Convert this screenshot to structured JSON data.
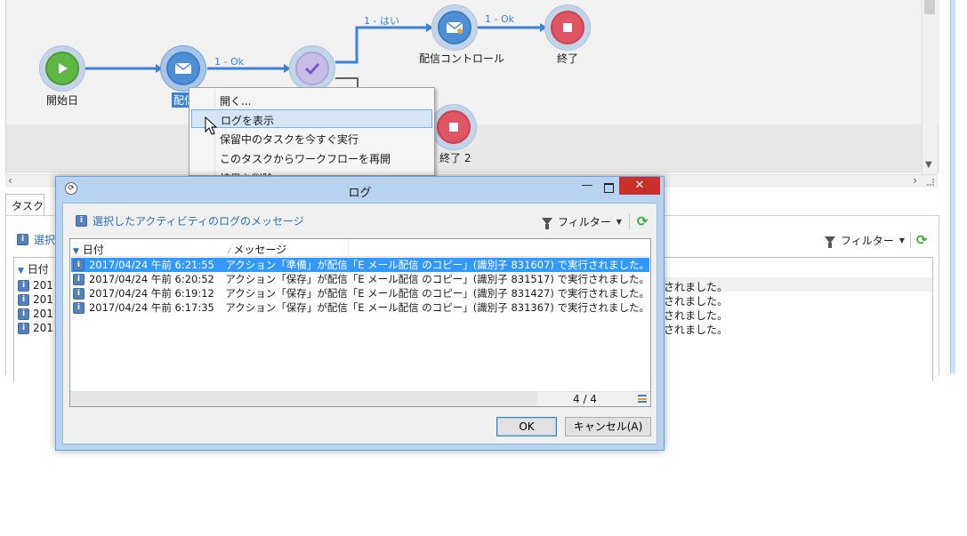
{
  "workflow": {
    "nodes": {
      "start": "開始日",
      "delivery": "配信",
      "delivery_control": "配信コントロール",
      "end": "終了",
      "end2": "終了 2"
    },
    "edges": {
      "delivery_to_approval": "1 - Ok",
      "approval_yes": "1 - はい",
      "control_to_end": "1 - Ok"
    }
  },
  "context_menu": {
    "items": [
      "開く...",
      "ログを表示",
      "保留中のタスクを今すぐ実行",
      "このタスクからワークフローを再開",
      "結果を削除"
    ],
    "highlighted_index": 1
  },
  "task_area": {
    "tab": "タスク",
    "header": "選択",
    "filter_label": "フィルター",
    "date_column": "日付",
    "row_prefix": "201",
    "row_suffix": "されました。",
    "row_count": 4
  },
  "log_dialog": {
    "title": "ログ",
    "header": "選択したアクティビティのログのメッセージ",
    "filter_label": "フィルター",
    "columns": [
      "日付",
      "メッセージ"
    ],
    "rows": [
      {
        "date": "2017/04/24 午前 6:21:55",
        "message": "アクション「準備」が配信「E メール配信 のコピー」(識別子 831607) で実行されました。"
      },
      {
        "date": "2017/04/24 午前 6:20:52",
        "message": "アクション「保存」が配信「E メール配信 のコピー」(識別子 831517) で実行されました。"
      },
      {
        "date": "2017/04/24 午前 6:19:12",
        "message": "アクション「保存」が配信「E メール配信 のコピー」(識別子 831427) で実行されました。"
      },
      {
        "date": "2017/04/24 午前 6:17:35",
        "message": "アクション「保存」が配信「E メール配信 のコピー」(識別子 831367) で実行されました。"
      }
    ],
    "selected_row": 0,
    "record_count": "4 / 4",
    "ok_label": "OK",
    "cancel_label": "キャンセル(A)"
  },
  "colors": {
    "accent": "#3b82d6",
    "selection": "#3399ff",
    "start_node": "#5fb845",
    "end_node": "#e05562",
    "close_button": "#c9302c"
  }
}
